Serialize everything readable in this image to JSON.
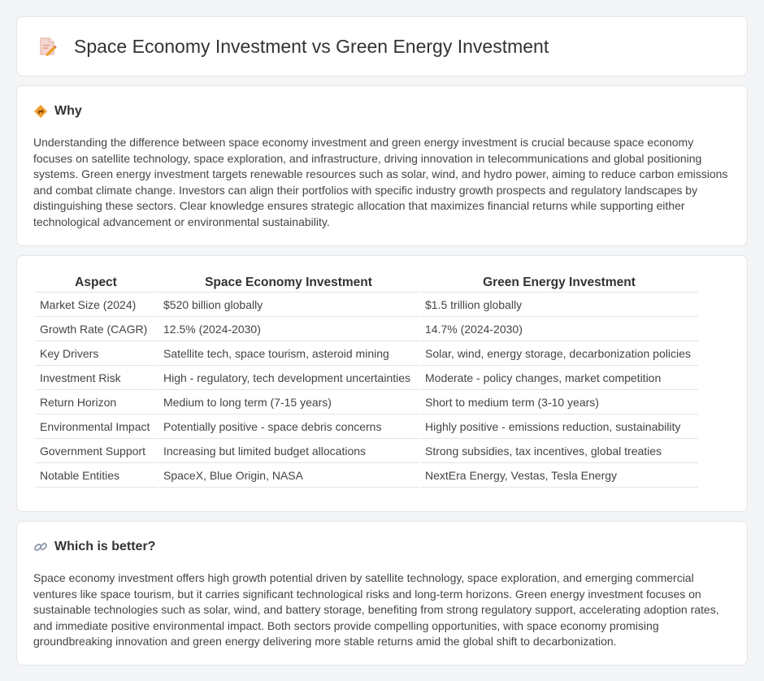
{
  "header": {
    "title": "Space Economy Investment vs Green Energy Investment",
    "icon": "document-pencil-icon"
  },
  "why": {
    "heading": "Why",
    "icon": "diamond-direction-icon",
    "text": "Understanding the difference between space economy investment and green energy investment is crucial because space economy focuses on satellite technology, space exploration, and infrastructure, driving innovation in telecommunications and global positioning systems. Green energy investment targets renewable resources such as solar, wind, and hydro power, aiming to reduce carbon emissions and combat climate change. Investors can align their portfolios with specific industry growth prospects and regulatory landscapes by distinguishing these sectors. Clear knowledge ensures strategic allocation that maximizes financial returns while supporting either technological advancement or environmental sustainability."
  },
  "table": {
    "headers": [
      "Aspect",
      "Space Economy Investment",
      "Green Energy Investment"
    ],
    "rows": [
      [
        "Market Size (2024)",
        "$520 billion globally",
        "$1.5 trillion globally"
      ],
      [
        "Growth Rate (CAGR)",
        "12.5% (2024-2030)",
        "14.7% (2024-2030)"
      ],
      [
        "Key Drivers",
        "Satellite tech, space tourism, asteroid mining",
        "Solar, wind, energy storage, decarbonization policies"
      ],
      [
        "Investment Risk",
        "High - regulatory, tech development uncertainties",
        "Moderate - policy changes, market competition"
      ],
      [
        "Return Horizon",
        "Medium to long term (7-15 years)",
        "Short to medium term (3-10 years)"
      ],
      [
        "Environmental Impact",
        "Potentially positive - space debris concerns",
        "Highly positive - emissions reduction, sustainability"
      ],
      [
        "Government Support",
        "Increasing but limited budget allocations",
        "Strong subsidies, tax incentives, global treaties"
      ],
      [
        "Notable Entities",
        "SpaceX, Blue Origin, NASA",
        "NextEra Energy, Vestas, Tesla Energy"
      ]
    ]
  },
  "better": {
    "heading": "Which is better?",
    "icon": "link-icon",
    "text": "Space economy investment offers high growth potential driven by satellite technology, space exploration, and emerging commercial ventures like space tourism, but it carries significant technological risks and long-term horizons. Green energy investment focuses on sustainable technologies such as solar, wind, and battery storage, benefiting from strong regulatory support, accelerating adoption rates, and immediate positive environmental impact. Both sectors provide compelling opportunities, with space economy promising groundbreaking innovation and green energy delivering more stable returns amid the global shift to decarbonization."
  },
  "colors": {
    "accent_orange": "#f0a030",
    "accent_red": "#e0604a"
  }
}
